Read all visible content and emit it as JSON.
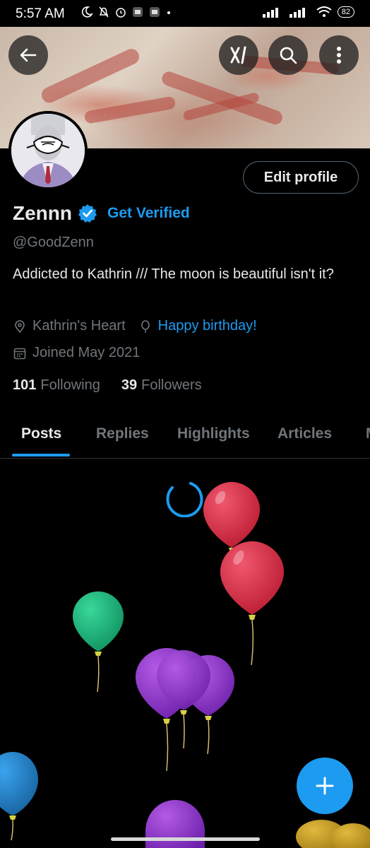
{
  "status_bar": {
    "time": "5:57 AM",
    "battery": "82"
  },
  "header": {
    "back_icon": "arrow-left-icon",
    "grok_icon": "grok-icon",
    "search_icon": "search-icon",
    "more_icon": "more-vertical-icon"
  },
  "profile": {
    "name": "Zennn",
    "get_verified": "Get Verified",
    "handle": "@GoodZenn",
    "bio": "Addicted to Kathrin /// The moon is beautiful isn't it?",
    "location": "Kathrin's Heart",
    "birthday": "Happy birthday!",
    "joined": "Joined May 2021",
    "following_count": "101",
    "following_label": "Following",
    "followers_count": "39",
    "followers_label": "Followers",
    "edit_profile": "Edit profile"
  },
  "tabs": [
    "Posts",
    "Replies",
    "Highlights",
    "Articles"
  ],
  "colors": {
    "accent": "#1d9bf0",
    "background": "#000000",
    "muted": "#71767b"
  }
}
